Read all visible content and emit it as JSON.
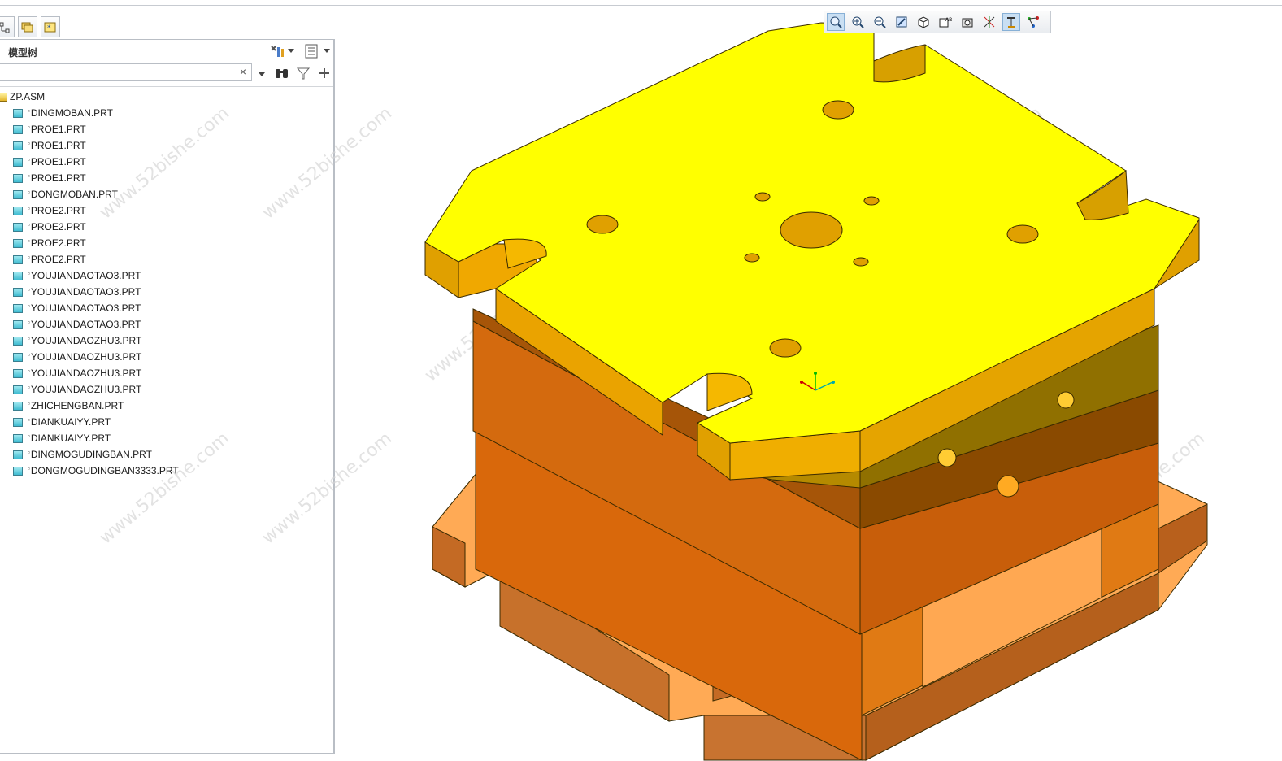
{
  "panel": {
    "title": "模型树"
  },
  "search": {
    "value": "",
    "clear_symbol": "×"
  },
  "tree": {
    "root": "ZP.ASM",
    "items": [
      {
        "label": "DINGMOBAN.PRT"
      },
      {
        "label": "PROE1.PRT"
      },
      {
        "label": "PROE1.PRT"
      },
      {
        "label": "PROE1.PRT"
      },
      {
        "label": "PROE1.PRT"
      },
      {
        "label": "DONGMOBAN.PRT"
      },
      {
        "label": "PROE2.PRT"
      },
      {
        "label": "PROE2.PRT"
      },
      {
        "label": "PROE2.PRT"
      },
      {
        "label": "PROE2.PRT"
      },
      {
        "label": "YOUJIANDAOTAO3.PRT"
      },
      {
        "label": "YOUJIANDAOTAO3.PRT"
      },
      {
        "label": "YOUJIANDAOTAO3.PRT"
      },
      {
        "label": "YOUJIANDAOTAO3.PRT"
      },
      {
        "label": "YOUJIANDAOZHU3.PRT"
      },
      {
        "label": "YOUJIANDAOZHU3.PRT"
      },
      {
        "label": "YOUJIANDAOZHU3.PRT"
      },
      {
        "label": "YOUJIANDAOZHU3.PRT"
      },
      {
        "label": "ZHICHENGBAN.PRT"
      },
      {
        "label": "DIANKUAIYY.PRT"
      },
      {
        "label": "DIANKUAIYY.PRT"
      },
      {
        "label": "DINGMOGUDINGBAN.PRT"
      },
      {
        "label": "DONGMOGUDINGBAN3333.PRT"
      }
    ]
  },
  "watermark": "www.52bishe.com",
  "view_toolbar_icons": [
    "refit-icon",
    "zoom-in-icon",
    "zoom-out-icon",
    "repaint-icon",
    "display-style-icon",
    "saved-views-icon",
    "view-manager-icon",
    "datum-display-icon",
    "spin-center-icon",
    "selection-icon"
  ],
  "colors": {
    "top_plate": "#ffff00",
    "orange_plate": "#d9680b",
    "light_orange": "#ffaa55",
    "olive": "#8a6a00"
  }
}
